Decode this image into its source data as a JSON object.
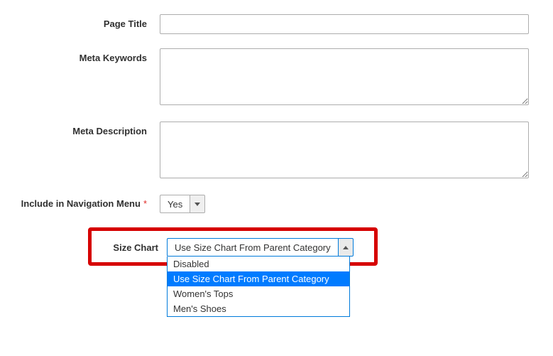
{
  "fields": {
    "pageTitle": {
      "label": "Page Title",
      "value": ""
    },
    "metaKeywords": {
      "label": "Meta Keywords",
      "value": ""
    },
    "metaDescription": {
      "label": "Meta Description",
      "value": ""
    },
    "includeNavMenu": {
      "label": "Include in Navigation Menu",
      "value": "Yes"
    },
    "sizeChart": {
      "label": "Size Chart",
      "value": "Use Size Chart From Parent Category",
      "options": {
        "0": "Disabled",
        "1": "Use Size Chart From Parent Category",
        "2": "Women's Tops",
        "3": "Men's Shoes"
      }
    }
  }
}
